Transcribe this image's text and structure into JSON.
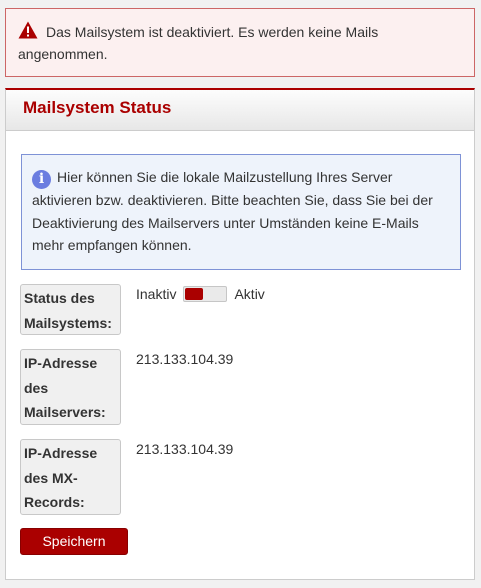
{
  "alert": {
    "icon": "warning-triangle-icon",
    "color": "#a00000",
    "text": "Das Mailsystem ist deaktiviert. Es werden keine Mails angenommen."
  },
  "panel": {
    "title": "Mailsystem Status",
    "info": {
      "icon": "info-icon",
      "text": "Hier können Sie die lokale Mailzustellung Ihres Server aktivieren bzw. deaktivieren. Bitte beachten Sie, dass Sie bei der Deaktivierung des Mailservers unter Umständen keine E-Mails mehr empfangen können."
    },
    "fields": {
      "status": {
        "label": "Status des Mailsystems:",
        "toggle_off_label": "Inaktiv",
        "toggle_on_label": "Aktiv",
        "enabled": false
      },
      "mailserver_ip": {
        "label": "IP-Adresse des Mailservers:",
        "value": "213.133.104.39"
      },
      "mx_ip": {
        "label": "IP-Adresse des MX-Records:",
        "value": "213.133.104.39"
      }
    },
    "save_label": "Speichern"
  }
}
